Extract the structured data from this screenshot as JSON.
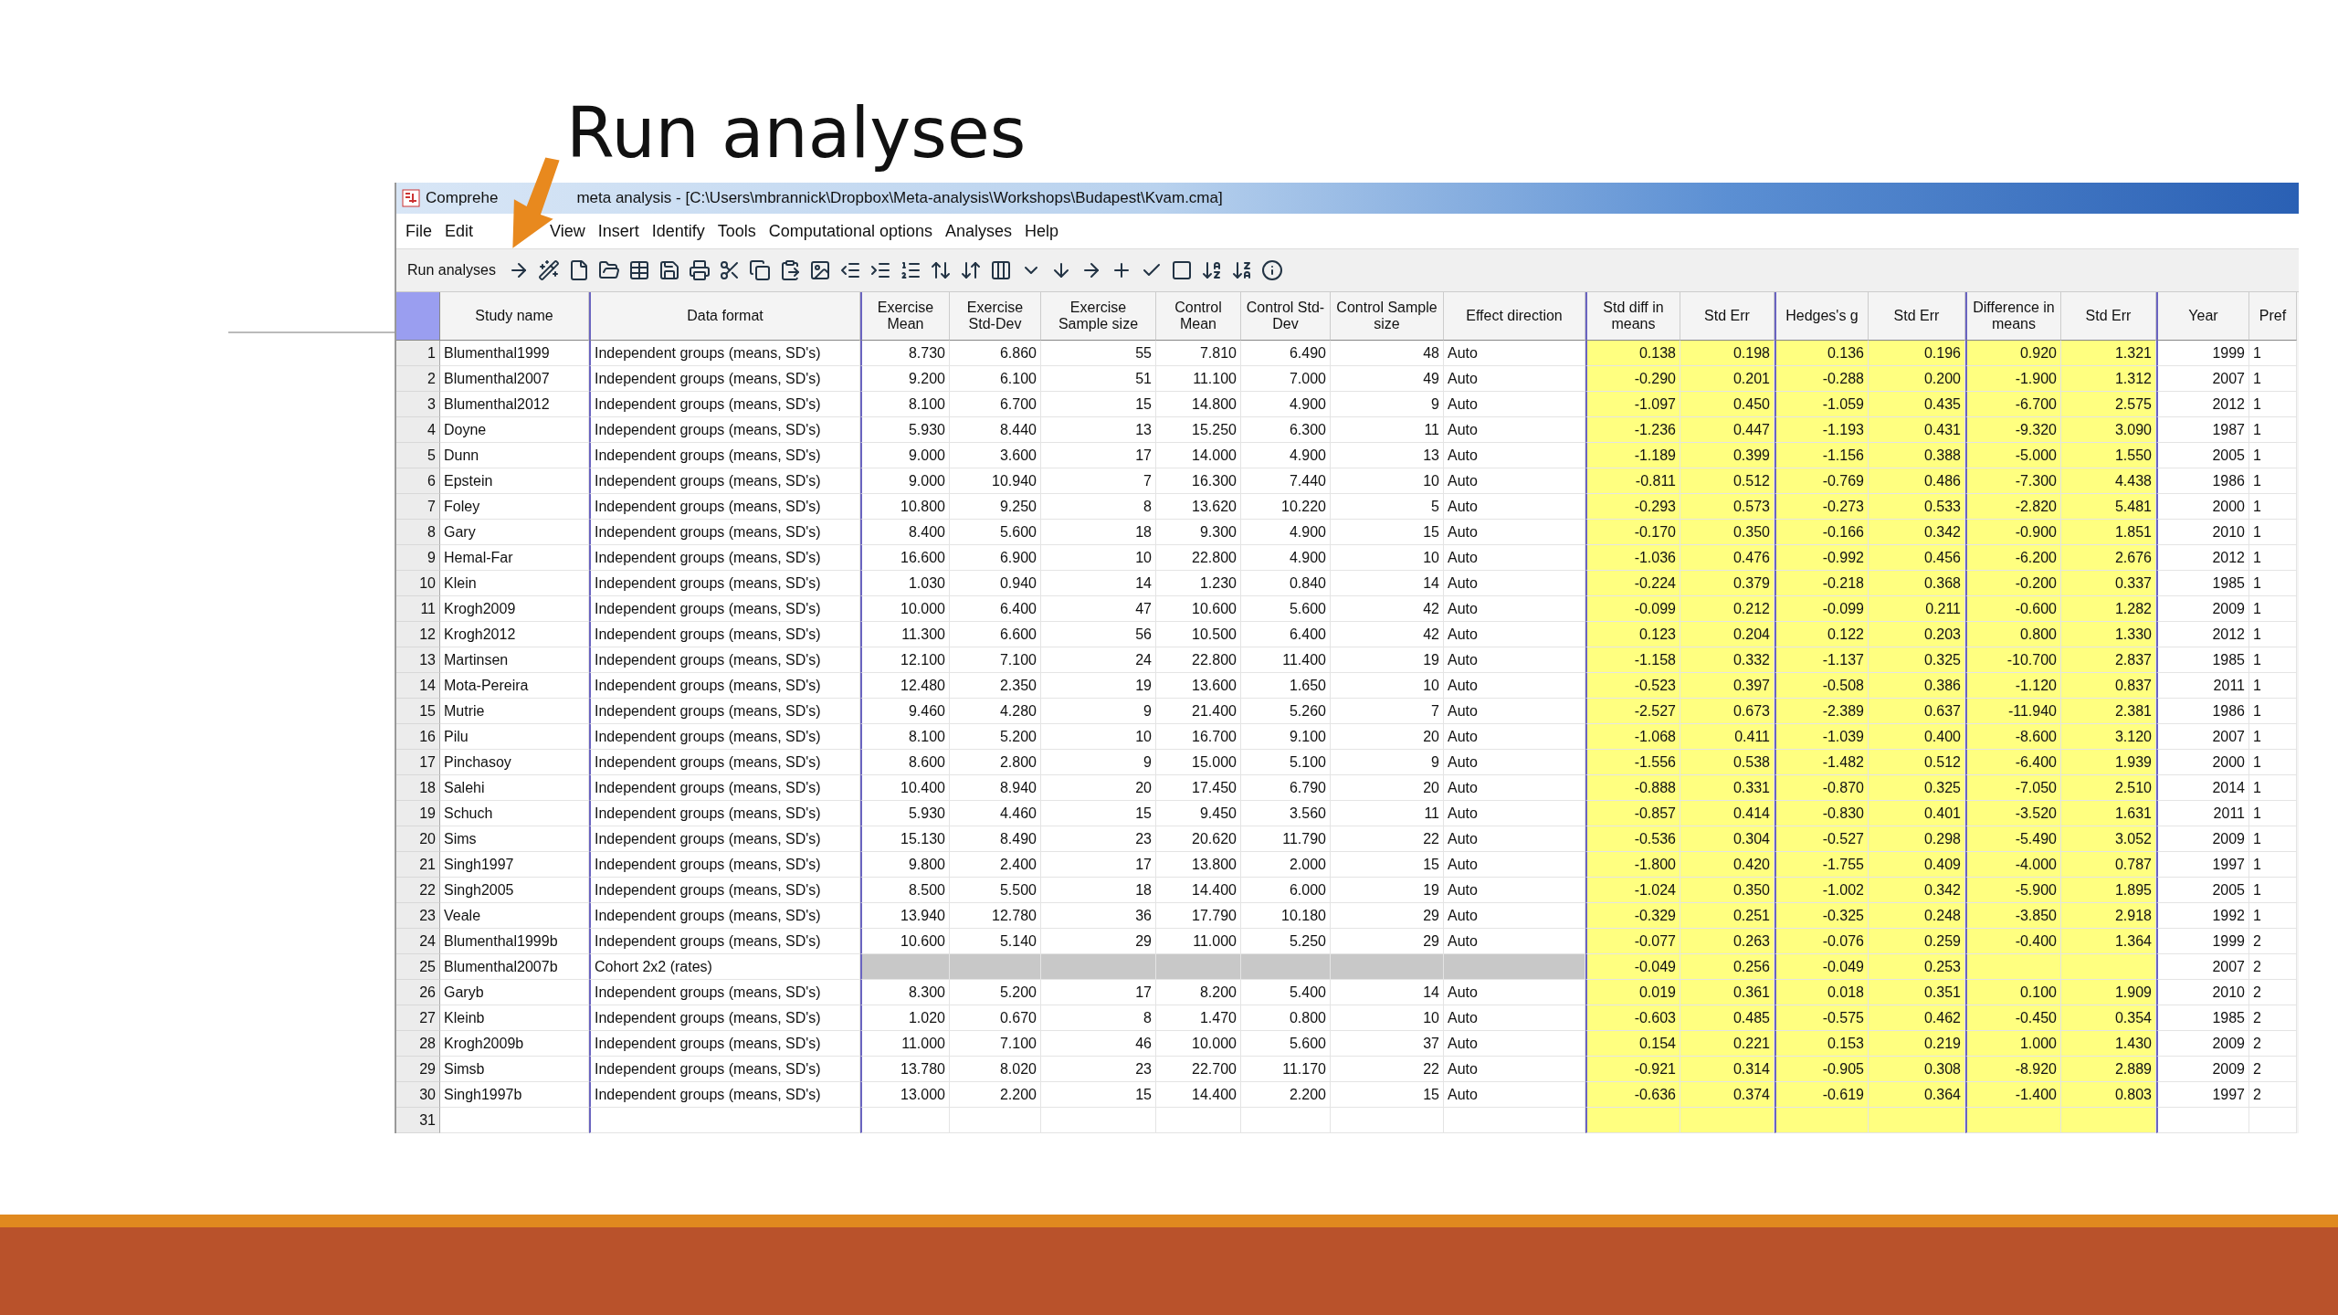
{
  "slide_title": "Run analyses",
  "window": {
    "title_parts": [
      "Comprehe",
      "meta analysis - [C:\\Users\\mbrannick\\Dropbox\\Meta-analysis\\Workshops\\Budapest\\Kvam.cma]"
    ]
  },
  "menu": [
    "File",
    "Edit",
    "View",
    "Insert",
    "Identify",
    "Tools",
    "Computational options",
    "Analyses",
    "Help"
  ],
  "toolbar": {
    "label": "Run analyses"
  },
  "table": {
    "columns": [
      {
        "header": "Study name",
        "kind": "label",
        "divider_before": false
      },
      {
        "header": "Data format",
        "kind": "label",
        "divider_before": true
      },
      {
        "header": "Exercise Mean",
        "kind": "input",
        "divider_before": true
      },
      {
        "header": "Exercise Std-Dev",
        "kind": "input",
        "divider_before": false
      },
      {
        "header": "Exercise Sample size",
        "kind": "input",
        "divider_before": false
      },
      {
        "header": "Control Mean",
        "kind": "input",
        "divider_before": false
      },
      {
        "header": "Control Std-Dev",
        "kind": "input",
        "divider_before": false
      },
      {
        "header": "Control Sample size",
        "kind": "input",
        "divider_before": false
      },
      {
        "header": "Effect direction",
        "kind": "option",
        "divider_before": false
      },
      {
        "header": "Std diff in means",
        "kind": "effect",
        "divider_before": true
      },
      {
        "header": "Std Err",
        "kind": "effect",
        "divider_before": false
      },
      {
        "header": "Hedges's g",
        "kind": "effect",
        "divider_before": true
      },
      {
        "header": "Std Err",
        "kind": "effect",
        "divider_before": false
      },
      {
        "header": "Difference in means",
        "kind": "effect",
        "divider_before": true
      },
      {
        "header": "Std Err",
        "kind": "effect",
        "divider_before": false
      },
      {
        "header": "Year",
        "kind": "info",
        "divider_before": true
      },
      {
        "header": "Pref",
        "kind": "group",
        "divider_before": false
      }
    ],
    "rows": [
      {
        "number": "1",
        "disabled": false,
        "cells": [
          "Blumenthal1999",
          "Independent groups (means, SD's)",
          "8.730",
          "6.860",
          "55",
          "7.810",
          "6.490",
          "48",
          "Auto",
          "0.138",
          "0.198",
          "0.136",
          "0.196",
          "0.920",
          "1.321",
          "1999",
          "1"
        ]
      },
      {
        "number": "2",
        "disabled": false,
        "cells": [
          "Blumenthal2007",
          "Independent groups (means, SD's)",
          "9.200",
          "6.100",
          "51",
          "11.100",
          "7.000",
          "49",
          "Auto",
          "-0.290",
          "0.201",
          "-0.288",
          "0.200",
          "-1.900",
          "1.312",
          "2007",
          "1"
        ]
      },
      {
        "number": "3",
        "disabled": false,
        "cells": [
          "Blumenthal2012",
          "Independent groups (means, SD's)",
          "8.100",
          "6.700",
          "15",
          "14.800",
          "4.900",
          "9",
          "Auto",
          "-1.097",
          "0.450",
          "-1.059",
          "0.435",
          "-6.700",
          "2.575",
          "2012",
          "1"
        ]
      },
      {
        "number": "4",
        "disabled": false,
        "cells": [
          "Doyne",
          "Independent groups (means, SD's)",
          "5.930",
          "8.440",
          "13",
          "15.250",
          "6.300",
          "11",
          "Auto",
          "-1.236",
          "0.447",
          "-1.193",
          "0.431",
          "-9.320",
          "3.090",
          "1987",
          "1"
        ]
      },
      {
        "number": "5",
        "disabled": false,
        "cells": [
          "Dunn",
          "Independent groups (means, SD's)",
          "9.000",
          "3.600",
          "17",
          "14.000",
          "4.900",
          "13",
          "Auto",
          "-1.189",
          "0.399",
          "-1.156",
          "0.388",
          "-5.000",
          "1.550",
          "2005",
          "1"
        ]
      },
      {
        "number": "6",
        "disabled": false,
        "cells": [
          "Epstein",
          "Independent groups (means, SD's)",
          "9.000",
          "10.940",
          "7",
          "16.300",
          "7.440",
          "10",
          "Auto",
          "-0.811",
          "0.512",
          "-0.769",
          "0.486",
          "-7.300",
          "4.438",
          "1986",
          "1"
        ]
      },
      {
        "number": "7",
        "disabled": false,
        "cells": [
          "Foley",
          "Independent groups (means, SD's)",
          "10.800",
          "9.250",
          "8",
          "13.620",
          "10.220",
          "5",
          "Auto",
          "-0.293",
          "0.573",
          "-0.273",
          "0.533",
          "-2.820",
          "5.481",
          "2000",
          "1"
        ]
      },
      {
        "number": "8",
        "disabled": false,
        "cells": [
          "Gary",
          "Independent groups (means, SD's)",
          "8.400",
          "5.600",
          "18",
          "9.300",
          "4.900",
          "15",
          "Auto",
          "-0.170",
          "0.350",
          "-0.166",
          "0.342",
          "-0.900",
          "1.851",
          "2010",
          "1"
        ]
      },
      {
        "number": "9",
        "disabled": false,
        "cells": [
          "Hemal-Far",
          "Independent groups (means, SD's)",
          "16.600",
          "6.900",
          "10",
          "22.800",
          "4.900",
          "10",
          "Auto",
          "-1.036",
          "0.476",
          "-0.992",
          "0.456",
          "-6.200",
          "2.676",
          "2012",
          "1"
        ]
      },
      {
        "number": "10",
        "disabled": false,
        "cells": [
          "Klein",
          "Independent groups (means, SD's)",
          "1.030",
          "0.940",
          "14",
          "1.230",
          "0.840",
          "14",
          "Auto",
          "-0.224",
          "0.379",
          "-0.218",
          "0.368",
          "-0.200",
          "0.337",
          "1985",
          "1"
        ]
      },
      {
        "number": "11",
        "disabled": false,
        "cells": [
          "Krogh2009",
          "Independent groups (means, SD's)",
          "10.000",
          "6.400",
          "47",
          "10.600",
          "5.600",
          "42",
          "Auto",
          "-0.099",
          "0.212",
          "-0.099",
          "0.211",
          "-0.600",
          "1.282",
          "2009",
          "1"
        ]
      },
      {
        "number": "12",
        "disabled": false,
        "cells": [
          "Krogh2012",
          "Independent groups (means, SD's)",
          "11.300",
          "6.600",
          "56",
          "10.500",
          "6.400",
          "42",
          "Auto",
          "0.123",
          "0.204",
          "0.122",
          "0.203",
          "0.800",
          "1.330",
          "2012",
          "1"
        ]
      },
      {
        "number": "13",
        "disabled": false,
        "cells": [
          "Martinsen",
          "Independent groups (means, SD's)",
          "12.100",
          "7.100",
          "24",
          "22.800",
          "11.400",
          "19",
          "Auto",
          "-1.158",
          "0.332",
          "-1.137",
          "0.325",
          "-10.700",
          "2.837",
          "1985",
          "1"
        ]
      },
      {
        "number": "14",
        "disabled": false,
        "cells": [
          "Mota-Pereira",
          "Independent groups (means, SD's)",
          "12.480",
          "2.350",
          "19",
          "13.600",
          "1.650",
          "10",
          "Auto",
          "-0.523",
          "0.397",
          "-0.508",
          "0.386",
          "-1.120",
          "0.837",
          "2011",
          "1"
        ]
      },
      {
        "number": "15",
        "disabled": false,
        "cells": [
          "Mutrie",
          "Independent groups (means, SD's)",
          "9.460",
          "4.280",
          "9",
          "21.400",
          "5.260",
          "7",
          "Auto",
          "-2.527",
          "0.673",
          "-2.389",
          "0.637",
          "-11.940",
          "2.381",
          "1986",
          "1"
        ]
      },
      {
        "number": "16",
        "disabled": false,
        "cells": [
          "Pilu",
          "Independent groups (means, SD's)",
          "8.100",
          "5.200",
          "10",
          "16.700",
          "9.100",
          "20",
          "Auto",
          "-1.068",
          "0.411",
          "-1.039",
          "0.400",
          "-8.600",
          "3.120",
          "2007",
          "1"
        ]
      },
      {
        "number": "17",
        "disabled": false,
        "cells": [
          "Pinchasoy",
          "Independent groups (means, SD's)",
          "8.600",
          "2.800",
          "9",
          "15.000",
          "5.100",
          "9",
          "Auto",
          "-1.556",
          "0.538",
          "-1.482",
          "0.512",
          "-6.400",
          "1.939",
          "2000",
          "1"
        ]
      },
      {
        "number": "18",
        "disabled": false,
        "cells": [
          "Salehi",
          "Independent groups (means, SD's)",
          "10.400",
          "8.940",
          "20",
          "17.450",
          "6.790",
          "20",
          "Auto",
          "-0.888",
          "0.331",
          "-0.870",
          "0.325",
          "-7.050",
          "2.510",
          "2014",
          "1"
        ]
      },
      {
        "number": "19",
        "disabled": false,
        "cells": [
          "Schuch",
          "Independent groups (means, SD's)",
          "5.930",
          "4.460",
          "15",
          "9.450",
          "3.560",
          "11",
          "Auto",
          "-0.857",
          "0.414",
          "-0.830",
          "0.401",
          "-3.520",
          "1.631",
          "2011",
          "1"
        ]
      },
      {
        "number": "20",
        "disabled": false,
        "cells": [
          "Sims",
          "Independent groups (means, SD's)",
          "15.130",
          "8.490",
          "23",
          "20.620",
          "11.790",
          "22",
          "Auto",
          "-0.536",
          "0.304",
          "-0.527",
          "0.298",
          "-5.490",
          "3.052",
          "2009",
          "1"
        ]
      },
      {
        "number": "21",
        "disabled": false,
        "cells": [
          "Singh1997",
          "Independent groups (means, SD's)",
          "9.800",
          "2.400",
          "17",
          "13.800",
          "2.000",
          "15",
          "Auto",
          "-1.800",
          "0.420",
          "-1.755",
          "0.409",
          "-4.000",
          "0.787",
          "1997",
          "1"
        ]
      },
      {
        "number": "22",
        "disabled": false,
        "cells": [
          "Singh2005",
          "Independent groups (means, SD's)",
          "8.500",
          "5.500",
          "18",
          "14.400",
          "6.000",
          "19",
          "Auto",
          "-1.024",
          "0.350",
          "-1.002",
          "0.342",
          "-5.900",
          "1.895",
          "2005",
          "1"
        ]
      },
      {
        "number": "23",
        "disabled": false,
        "cells": [
          "Veale",
          "Independent groups (means, SD's)",
          "13.940",
          "12.780",
          "36",
          "17.790",
          "10.180",
          "29",
          "Auto",
          "-0.329",
          "0.251",
          "-0.325",
          "0.248",
          "-3.850",
          "2.918",
          "1992",
          "1"
        ]
      },
      {
        "number": "24",
        "disabled": false,
        "cells": [
          "Blumenthal1999b",
          "Independent groups (means, SD's)",
          "10.600",
          "5.140",
          "29",
          "11.000",
          "5.250",
          "29",
          "Auto",
          "-0.077",
          "0.263",
          "-0.076",
          "0.259",
          "-0.400",
          "1.364",
          "1999",
          "2"
        ]
      },
      {
        "number": "25",
        "disabled": true,
        "cells": [
          "Blumenthal2007b",
          "Cohort 2x2 (rates)",
          null,
          null,
          null,
          null,
          null,
          null,
          null,
          "-0.049",
          "0.256",
          "-0.049",
          "0.253",
          null,
          null,
          "2007",
          "2"
        ]
      },
      {
        "number": "26",
        "disabled": false,
        "cells": [
          "Garyb",
          "Independent groups (means, SD's)",
          "8.300",
          "5.200",
          "17",
          "8.200",
          "5.400",
          "14",
          "Auto",
          "0.019",
          "0.361",
          "0.018",
          "0.351",
          "0.100",
          "1.909",
          "2010",
          "2"
        ]
      },
      {
        "number": "27",
        "disabled": false,
        "cells": [
          "Kleinb",
          "Independent groups (means, SD's)",
          "1.020",
          "0.670",
          "8",
          "1.470",
          "0.800",
          "10",
          "Auto",
          "-0.603",
          "0.485",
          "-0.575",
          "0.462",
          "-0.450",
          "0.354",
          "1985",
          "2"
        ]
      },
      {
        "number": "28",
        "disabled": false,
        "cells": [
          "Krogh2009b",
          "Independent groups (means, SD's)",
          "11.000",
          "7.100",
          "46",
          "10.000",
          "5.600",
          "37",
          "Auto",
          "0.154",
          "0.221",
          "0.153",
          "0.219",
          "1.000",
          "1.430",
          "2009",
          "2"
        ]
      },
      {
        "number": "29",
        "disabled": false,
        "cells": [
          "Simsb",
          "Independent groups (means, SD's)",
          "13.780",
          "8.020",
          "23",
          "22.700",
          "11.170",
          "22",
          "Auto",
          "-0.921",
          "0.314",
          "-0.905",
          "0.308",
          "-8.920",
          "2.889",
          "2009",
          "2"
        ]
      },
      {
        "number": "30",
        "disabled": false,
        "cells": [
          "Singh1997b",
          "Independent groups (means, SD's)",
          "13.000",
          "2.200",
          "15",
          "14.400",
          "2.200",
          "15",
          "Auto",
          "-0.636",
          "0.374",
          "-0.619",
          "0.364",
          "-1.400",
          "0.803",
          "1997",
          "2"
        ]
      },
      {
        "number": "31",
        "disabled": false
      }
    ]
  }
}
